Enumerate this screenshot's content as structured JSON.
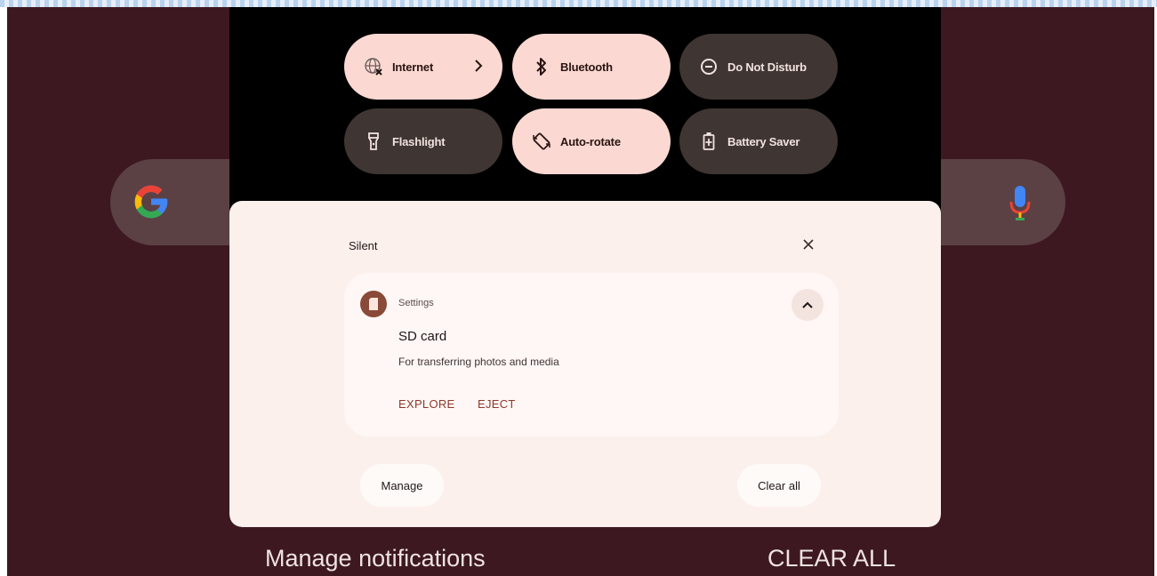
{
  "quick_settings": {
    "tiles": [
      {
        "label": "Internet",
        "icon": "internet-globe-icon",
        "state": "on",
        "has_chevron": true
      },
      {
        "label": "Bluetooth",
        "icon": "bluetooth-icon",
        "state": "on"
      },
      {
        "label": "Do Not Disturb",
        "icon": "do-not-disturb-icon",
        "state": "off"
      },
      {
        "label": "Flashlight",
        "icon": "flashlight-icon",
        "state": "off"
      },
      {
        "label": "Auto-rotate",
        "icon": "auto-rotate-icon",
        "state": "on"
      },
      {
        "label": "Battery Saver",
        "icon": "battery-saver-icon",
        "state": "off"
      }
    ]
  },
  "notifications": {
    "section_label": "Silent",
    "items": [
      {
        "app_name": "Settings",
        "title": "SD card",
        "text": "For transferring photos and media",
        "actions": [
          "EXPLORE",
          "EJECT"
        ]
      }
    ],
    "manage_label": "Manage",
    "clear_all_label": "Clear all"
  },
  "background": {
    "manage_notifications_label": "Manage notifications",
    "clear_all_label": "CLEAR ALL"
  },
  "colors": {
    "wallpaper": "#3d1820",
    "tile_on": "#fbd9d2",
    "tile_off": "#3f3533",
    "panel": "#fcf0ed",
    "accent_action": "#8d3a2b"
  }
}
